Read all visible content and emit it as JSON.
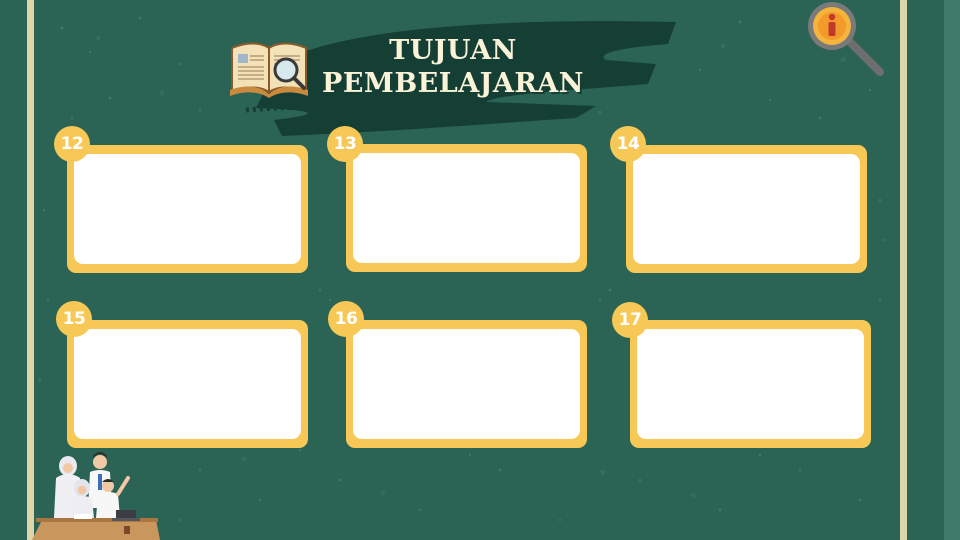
{
  "title": {
    "line1": "TUJUAN",
    "line2": "PEMBELAJARAN"
  },
  "cards": [
    {
      "number": "12"
    },
    {
      "number": "13"
    },
    {
      "number": "14"
    },
    {
      "number": "15"
    },
    {
      "number": "16"
    },
    {
      "number": "17"
    }
  ],
  "colors": {
    "background": "#2b6454",
    "brush": "#153f35",
    "card": "#f7c856",
    "card_inner": "#ffffff",
    "frame": "#ddd5ac",
    "title_text": "#fbf3d8"
  },
  "icons": {
    "book": "open-book-with-magnifier-icon",
    "info": "info-magnifier-icon",
    "students": "students-illustration"
  }
}
